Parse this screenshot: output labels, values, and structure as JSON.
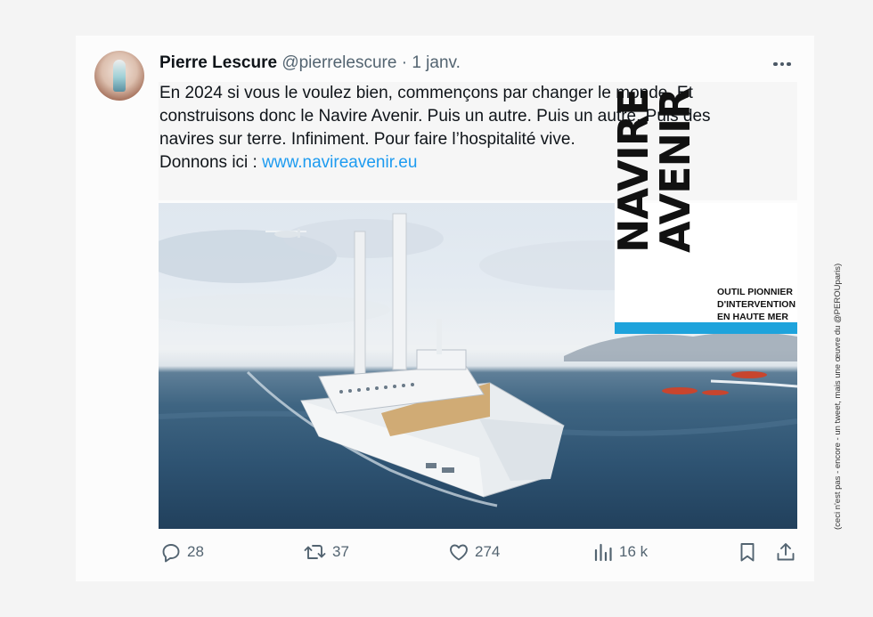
{
  "tweet": {
    "author_name": "Pierre Lescure",
    "handle": "@pierrelescure",
    "separator": "·",
    "date": "1 janv.",
    "text_lines": [
      "En 2024 si vous le voulez bien, commençons par changer le monde. Et",
      "construisons donc le Navire Avenir. Puis un autre. Puis un autre. Puis des",
      "navires sur terre. Infiniment. Pour faire l’hospitalité vive."
    ],
    "donate_prefix": "Donnons ici : ",
    "link_text": "www.navireavenir.eu"
  },
  "media": {
    "logo_line1": "NAVIRE",
    "logo_line2": "AVENIR",
    "logo_subtitle": [
      "OUTIL PIONNIER",
      "D'INTERVENTION",
      "EN HAUTE MER"
    ],
    "accent_color": "#1ea3dc"
  },
  "actions": {
    "replies": "28",
    "reposts": "37",
    "likes": "274",
    "views": "16 k"
  },
  "icons": [
    "more-icon",
    "reply-icon",
    "repost-icon",
    "like-icon",
    "views-icon",
    "bookmark-icon",
    "share-icon"
  ],
  "side_note": "(ceci n'est pas - encore - un tweet, mais une œuvre du @PEROUparis)",
  "colors": {
    "link": "#1d9bf0",
    "muted": "#536471",
    "text": "#0f1419"
  }
}
